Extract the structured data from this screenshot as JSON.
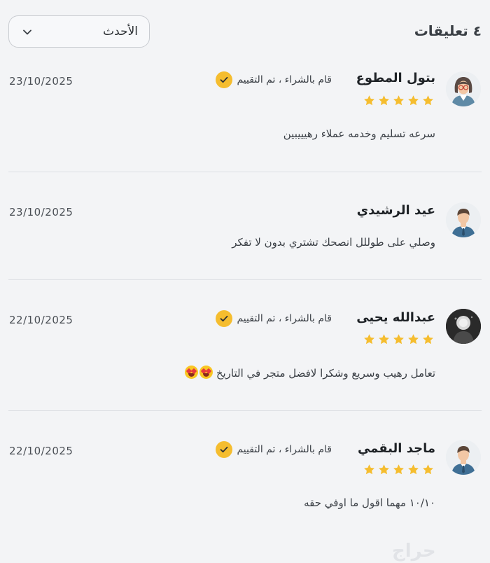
{
  "header": {
    "title": "٤ تعليقات",
    "sort_value": "الأحدث"
  },
  "reviews": [
    {
      "name": "بتول المطوع",
      "avatar": "female-avatar-icon",
      "rating": 5,
      "verified_text": "قام بالشراء ، تم التقييم",
      "date": "23/10/2025",
      "comment": "سرعه تسليم وخدمه عملاء رهيييبين"
    },
    {
      "name": "عيد الرشيدي",
      "avatar": "male-avatar-icon",
      "rating": null,
      "verified_text": "",
      "date": "23/10/2025",
      "comment": "وصلي على طوللل انصحك تشتري بدون لا تفكر"
    },
    {
      "name": "عبدالله يحيى",
      "avatar": "photo-avatar",
      "rating": 5,
      "verified_text": "قام بالشراء ، تم التقييم",
      "date": "22/10/2025",
      "comment": "تعامل رهيب وسريع وشكرا لافضل متجر في التاريخ"
    },
    {
      "name": "ماجد البقمي",
      "avatar": "male-avatar-icon",
      "rating": 5,
      "verified_text": "قام بالشراء ، تم التقييم",
      "date": "22/10/2025",
      "comment": "١٠/١٠ مهما اقول ما اوفي حقه"
    }
  ],
  "colors": {
    "accent": "#f5bd2f",
    "background": "#f3f4f6",
    "divider": "#dcdfe3"
  },
  "watermark": "حراج"
}
